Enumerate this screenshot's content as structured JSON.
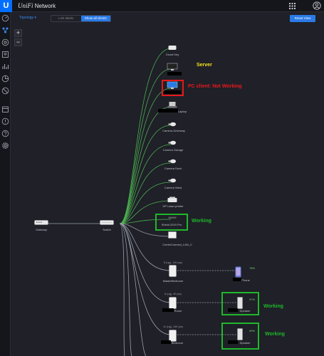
{
  "app": {
    "brand_script": "UniFi",
    "brand_text": "Network"
  },
  "toolbar": {
    "topology": "Topology",
    "labels": "Link labels",
    "show_all": "Show all clients",
    "reset": "Reset View"
  },
  "zoom": {
    "plus": "+",
    "minus": "−"
  },
  "devices": {
    "gateway": "Gateway",
    "switch": "Switch",
    "cloud_key": "Cloud Key",
    "laptop": "Laptop",
    "cam_driveway": "Camera Driveway",
    "cam_garage": "Camera Garage",
    "cam_deck": "Camera Deck",
    "cam_west": "Camera West",
    "printer": "HP Laser printer",
    "shield": "Shield 2019 Pro",
    "comfo": "ComfoConnect_LAN_C",
    "ap1": "MasterBedroom",
    "ap1_meta": "5 (ng), 149 (ac)",
    "ap1_client": "Phone",
    "ap1_pct": "78%",
    "ap2": "Room",
    "ap2_meta": "6 (ng), 40 (ac)",
    "ap2_client": "Speaker",
    "ap2_pct": "97%",
    "ap3": "Bedroom",
    "ap3_meta": "11 (ng), 149 (ac)",
    "ap3_client": "Speaker",
    "ap3_pct": "99%"
  },
  "annotations": {
    "server": "Server",
    "pc_client": "PC client: Not Working",
    "working1": "Working",
    "working2": "Working",
    "working3": "Working"
  },
  "colors": {
    "accent": "#2a7be6",
    "link_green": "#4caf50",
    "link_gray": "#8a8f99",
    "annotation_green": "#1fb82a",
    "annotation_red": "#e8181c",
    "server_yellow": "#f4e31c"
  }
}
